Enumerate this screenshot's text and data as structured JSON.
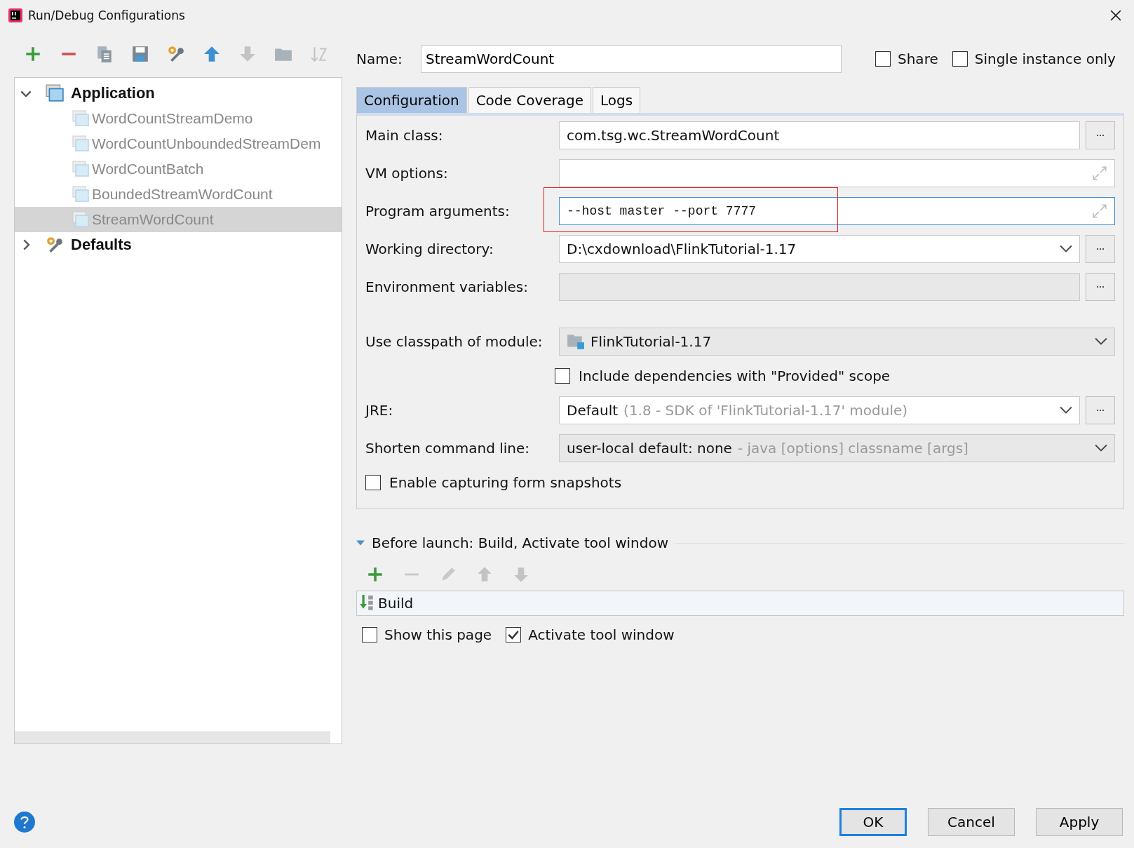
{
  "window": {
    "title": "Run/Debug Configurations"
  },
  "tree": [
    {
      "label": "Application",
      "expanded": true,
      "children": [
        {
          "label": "WordCountStreamDemo",
          "selected": false
        },
        {
          "label": "WordCountUnboundedStreamDem",
          "selected": false
        },
        {
          "label": "WordCountBatch",
          "selected": false
        },
        {
          "label": "BoundedStreamWordCount",
          "selected": false
        },
        {
          "label": "StreamWordCount",
          "selected": true
        }
      ]
    },
    {
      "label": "Defaults",
      "expanded": false
    }
  ],
  "name_field": {
    "label": "Name:",
    "value": "StreamWordCount"
  },
  "share": {
    "label": "Share",
    "checked": false
  },
  "single_instance": {
    "label": "Single instance only",
    "checked": false
  },
  "tabs": [
    {
      "label": "Configuration",
      "selected": true
    },
    {
      "label": "Code Coverage",
      "selected": false
    },
    {
      "label": "Logs",
      "selected": false
    }
  ],
  "form": [
    {
      "kind": "browse",
      "label": "Main class:",
      "value": "com.tsg.wc.StreamWordCount",
      "focused": false,
      "highlighted": false
    },
    {
      "kind": "expand",
      "label": "VM options:",
      "focused": false,
      "highlighted": false
    },
    {
      "kind": "expand",
      "label": "Program arguments:",
      "value": "--host master --port 7777",
      "mono": true,
      "focused": true,
      "highlighted": true
    },
    {
      "kind": "dropdown_browse",
      "label": "Working directory:",
      "value": "D:\\cxdownload\\FlinkTutorial-1.17",
      "focused": false,
      "highlighted": false
    },
    {
      "kind": "readonly_browse",
      "label": "Environment variables:",
      "focused": false,
      "highlighted": false
    },
    {
      "kind": "module",
      "label": "Use classpath of module:",
      "value": "FlinkTutorial-1.17",
      "focused": false,
      "highlighted": false
    },
    {
      "kind": "checkbox",
      "label": "Include dependencies with \"Provided\" scope",
      "checked": false
    },
    {
      "kind": "dropdown_browse",
      "label": "JRE:",
      "value": "Default",
      "hint": "(1.8 - SDK of 'FlinkTutorial-1.17' module)",
      "focused": false,
      "highlighted": false
    },
    {
      "kind": "combo",
      "label": "Shorten command line:",
      "value": "user-local default: none",
      "hint": "- java [options] classname [args]",
      "focused": false,
      "highlighted": false
    },
    {
      "kind": "checkbox_left",
      "label": "Enable capturing form snapshots",
      "checked": false
    }
  ],
  "before_launch": {
    "title": "Before launch: Build, Activate tool window",
    "expanded": true,
    "tasks": [
      "Build"
    ]
  },
  "show_this_page": {
    "label": "Show this page",
    "checked": false
  },
  "activate_tool_window": {
    "label": "Activate tool window",
    "checked": true
  },
  "buttons": [
    {
      "label": "OK",
      "default": true
    },
    {
      "label": "Cancel",
      "default": false
    },
    {
      "label": "Apply",
      "default": false
    }
  ]
}
